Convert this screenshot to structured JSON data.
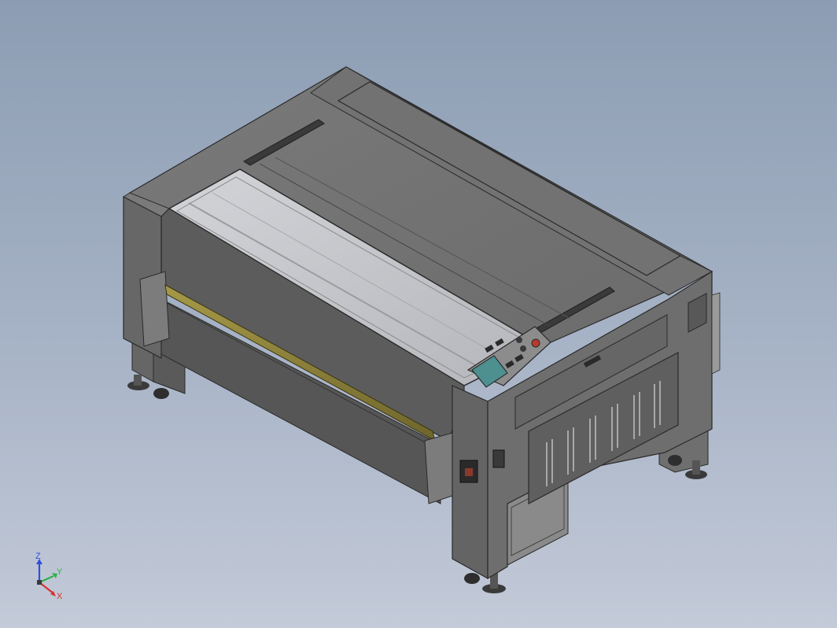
{
  "viewport": {
    "background_top": "#8c9db3",
    "background_bottom": "#c3cad8"
  },
  "model": {
    "description_icon": "laser-cutting-machine-model",
    "body_color": "#6b6b6b",
    "door_color": "#5c5c5c",
    "glass_color": "#bfc1c6",
    "roller_color": "#8a7f3a",
    "screen_color": "#4e8f90",
    "estop_color": "#b83a2c"
  },
  "triad": {
    "z_label": "Z",
    "y_label": "Y",
    "x_label": "X",
    "z_color": "#2f4fd8",
    "y_color": "#2fb04a",
    "x_color": "#d83030"
  }
}
